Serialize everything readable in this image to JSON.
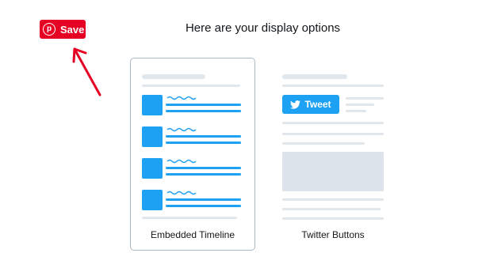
{
  "save_button": {
    "label": "Save",
    "icon": "pinterest-icon",
    "color": "#e60023"
  },
  "heading": "Here are your display options",
  "options": [
    {
      "label": "Embedded Timeline",
      "selected": true
    },
    {
      "label": "Twitter Buttons",
      "selected": false
    }
  ],
  "tweet_button": {
    "label": "Tweet",
    "icon": "twitter-bird-icon",
    "color": "#1da1f2"
  },
  "annotation": {
    "icon": "red-arrow-icon",
    "color": "#e60023"
  }
}
